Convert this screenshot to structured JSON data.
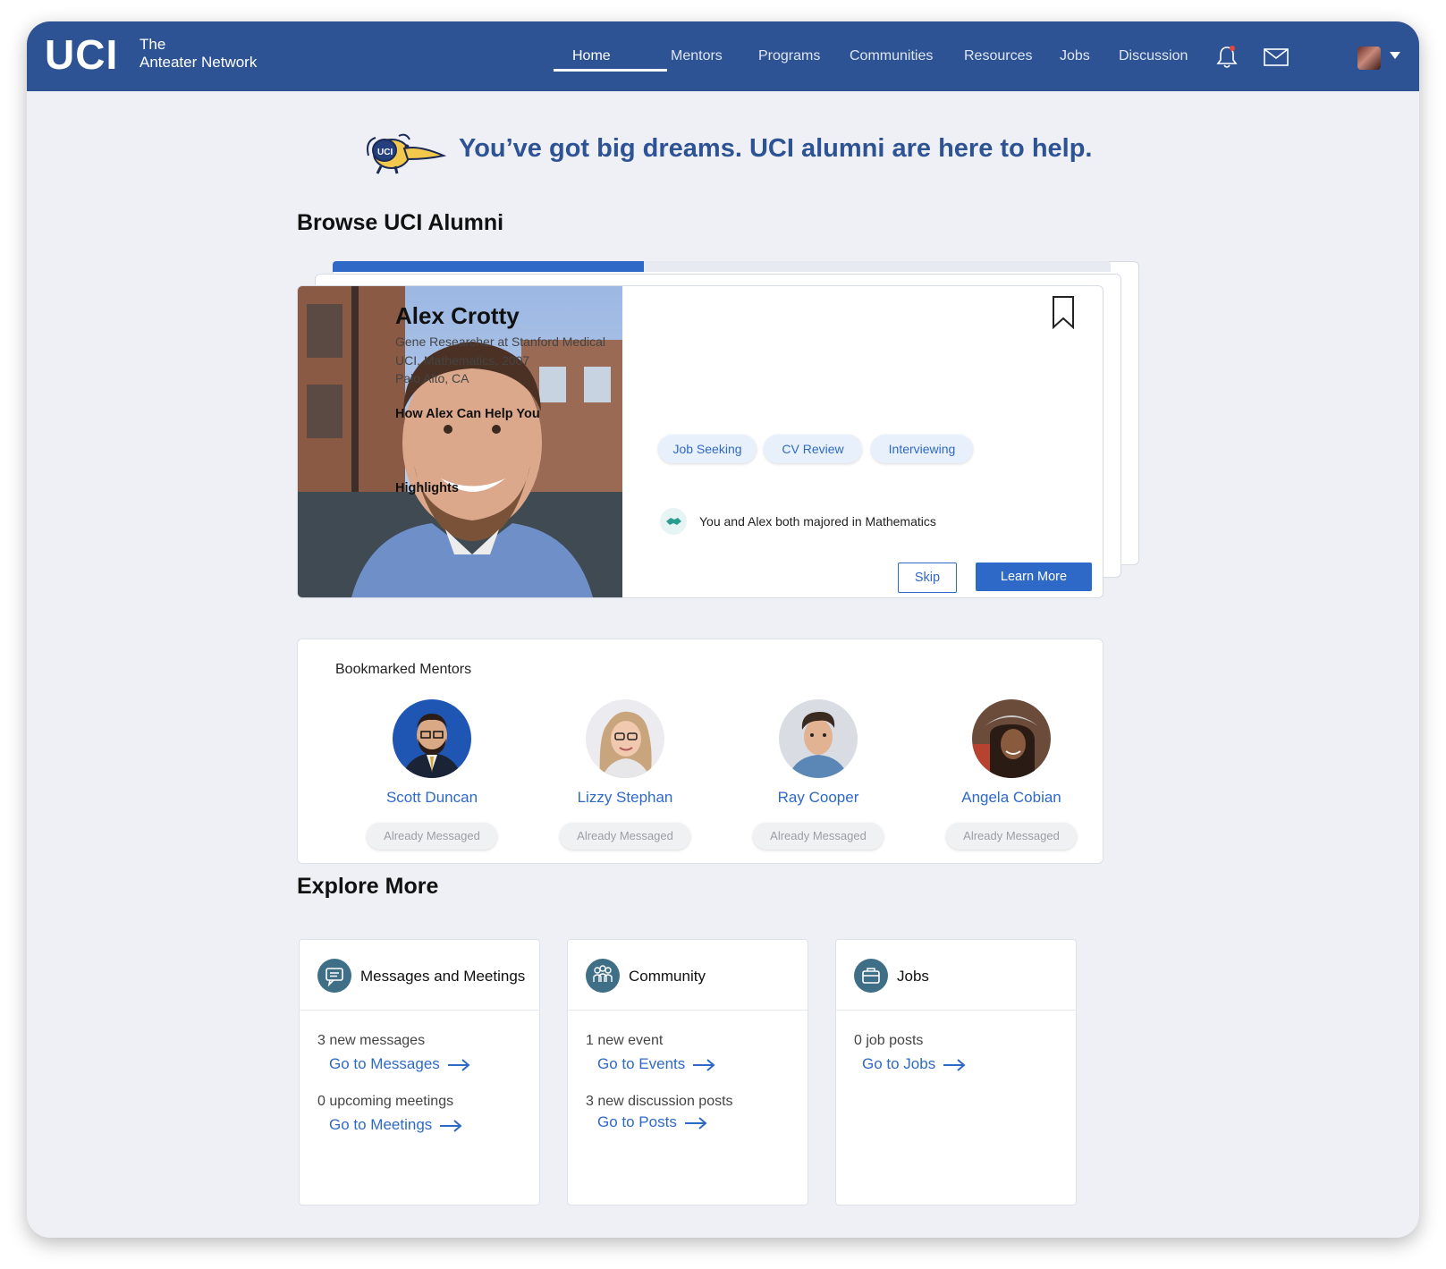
{
  "nav": {
    "logo": "UCI",
    "brand_line1": "The",
    "brand_line2": "Anteater Network",
    "items": [
      "Home",
      "Mentors",
      "Programs",
      "Communities",
      "Resources",
      "Jobs",
      "Discussion"
    ],
    "active": "Home",
    "icons": [
      "bell-icon",
      "mail-icon",
      "avatar",
      "caret-down-icon"
    ]
  },
  "hero": {
    "mascot_label": "UCI",
    "text": "You’ve got big dreams. UCI alumni are here to help."
  },
  "browse": {
    "title": "Browse UCI Alumni",
    "progress": 0.4,
    "card": {
      "name": "Alex Crotty",
      "role": "Gene Researcher at Stanford Medical",
      "education": "UCI, Mathematics, 2007",
      "location": "Palo Alto, CA",
      "help_title": "How Alex Can Help You",
      "help_chips": [
        "Job Seeking",
        "CV Review",
        "Interviewing"
      ],
      "highlights_title": "Highlights",
      "highlight": "You and Alex both majored in Mathematics",
      "skip_label": "Skip",
      "learn_more_label": "Learn More"
    }
  },
  "bookmarked": {
    "title": "Bookmarked Mentors",
    "mentors": [
      {
        "name": "Scott Duncan",
        "status": "Already Messaged"
      },
      {
        "name": "Lizzy Stephan",
        "status": "Already Messaged"
      },
      {
        "name": "Ray Cooper",
        "status": "Already Messaged"
      },
      {
        "name": "Angela Cobian",
        "status": "Already Messaged"
      }
    ]
  },
  "explore": {
    "title": "Explore More",
    "cards": [
      {
        "title": "Messages and Meetings",
        "line1": "3 new messages",
        "link1": "Go to Messages",
        "line2": "0 upcoming meetings",
        "link2": "Go to Meetings"
      },
      {
        "title": "Community",
        "line1": "1 new event",
        "link1": "Go to Events",
        "line2": "3 new discussion posts",
        "link2": "Go to Posts"
      },
      {
        "title": "Jobs",
        "line1": "0 job posts",
        "link1": "Go to Jobs"
      }
    ]
  },
  "colors": {
    "nav_bg": "#2d5394",
    "accent": "#2f69c8",
    "page_bg": "#eef0f5"
  }
}
